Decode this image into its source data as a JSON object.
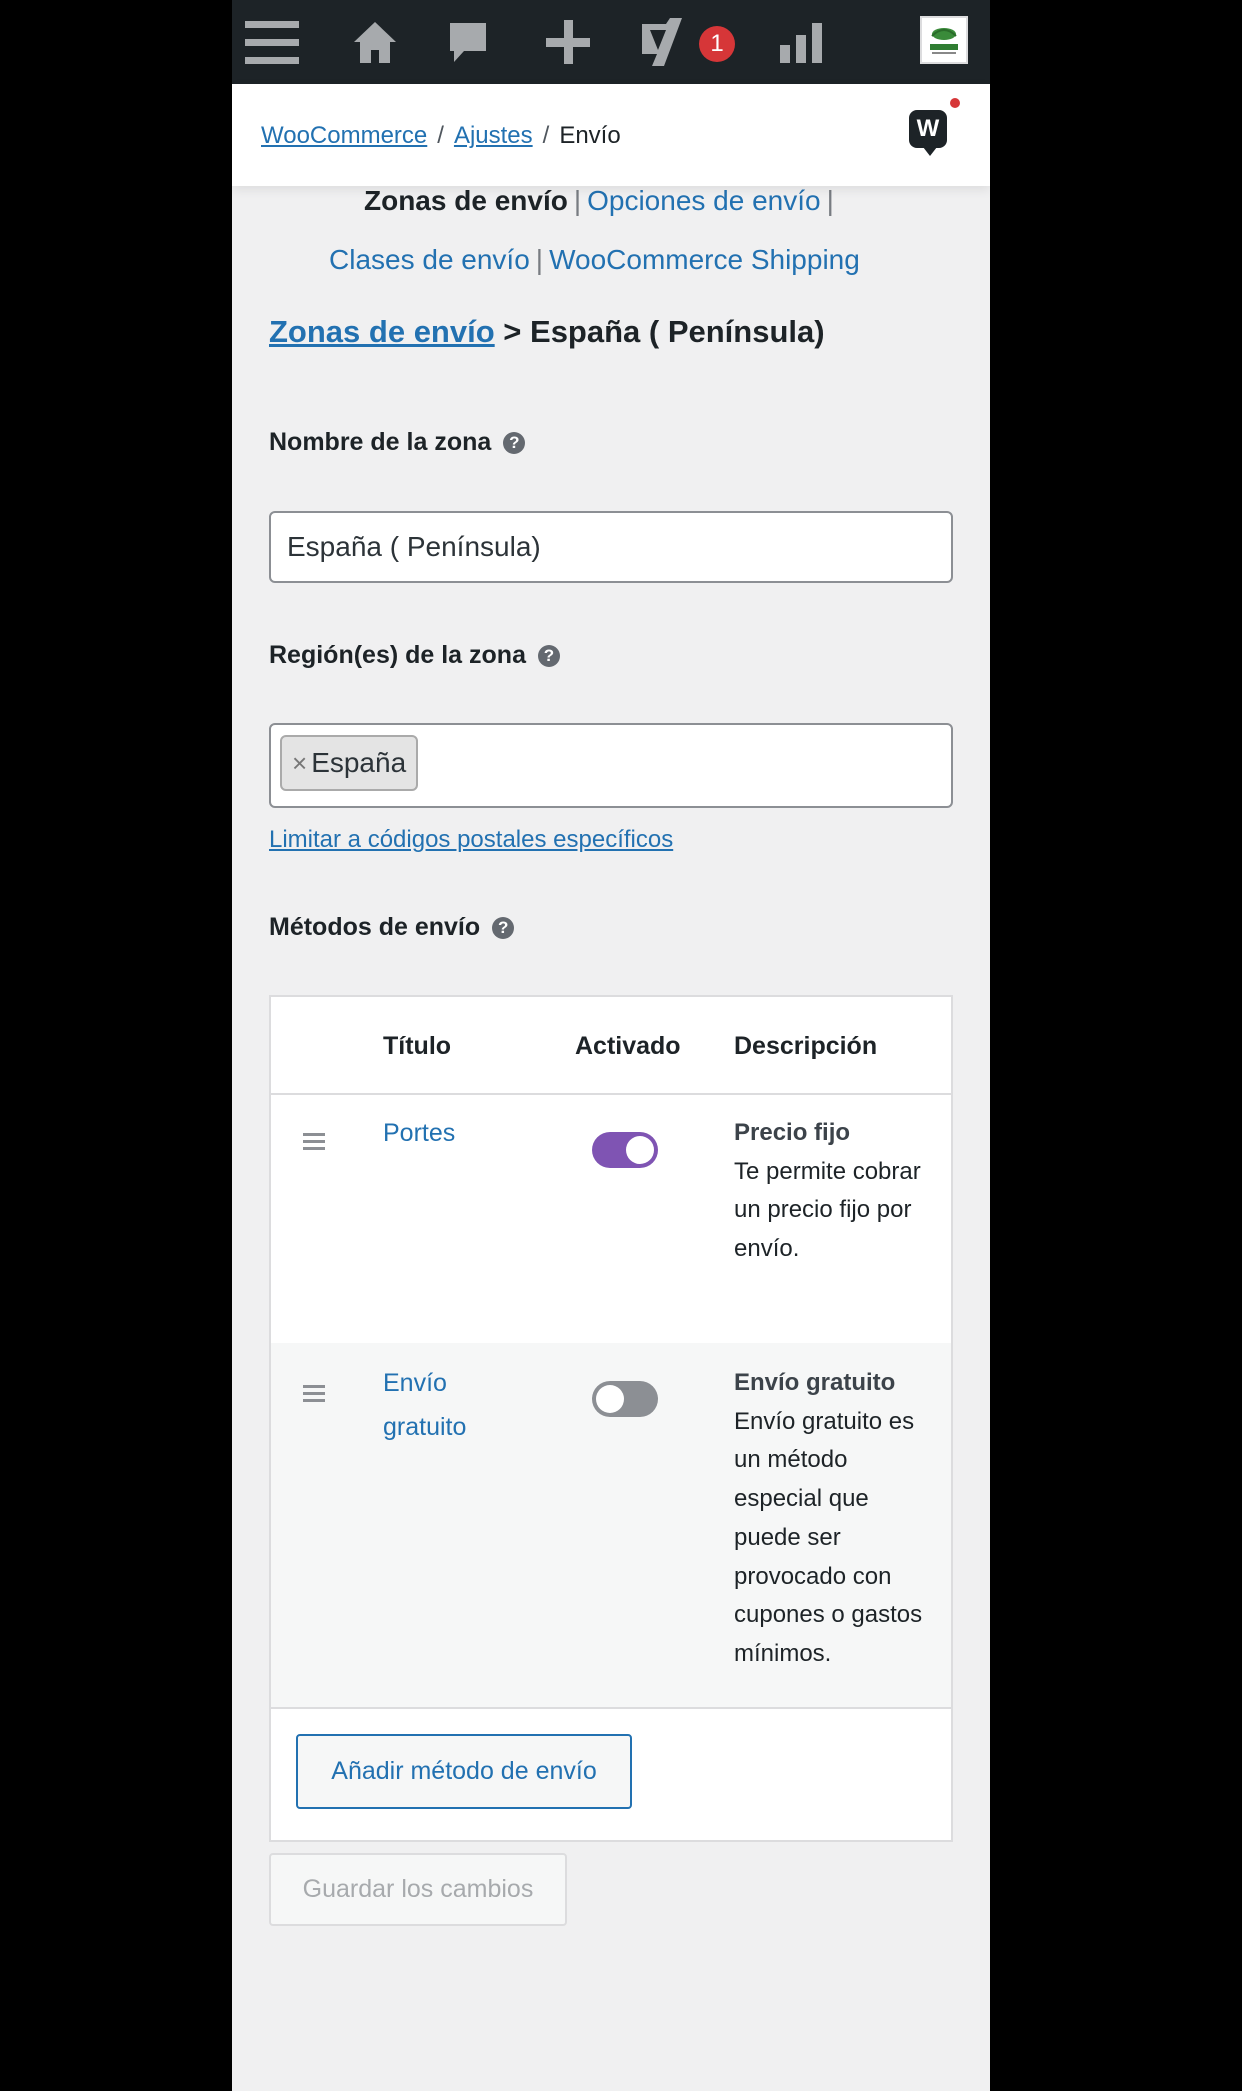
{
  "admin_bar": {
    "notification_count": "1",
    "icons": [
      "menu-icon",
      "home-icon",
      "comments-icon",
      "new-content-icon",
      "yoast-icon",
      "stats-icon"
    ]
  },
  "breadcrumb": {
    "items": [
      "WooCommerce",
      "Ajustes",
      "Envío"
    ],
    "separator": "/"
  },
  "help_bubble": {
    "letter": "W"
  },
  "subnav": {
    "current": "Zonas de envío",
    "links": [
      "Opciones de envío",
      "Clases de envío",
      "WooCommerce Shipping"
    ],
    "separator": "|"
  },
  "zone_heading": {
    "link": "Zonas de envío",
    "rest": "> España ( Península)"
  },
  "zone_name": {
    "label": "Nombre de la zona",
    "value": "España ( Península)"
  },
  "zone_regions": {
    "label": "Región(es) de la zona",
    "chips": [
      "España"
    ],
    "remove_symbol": "×",
    "postcode_link": "Limitar a códigos postales específicos"
  },
  "shipping_methods": {
    "label": "Métodos de envío",
    "columns": [
      "Título",
      "Activado",
      "Descripción"
    ],
    "rows": [
      {
        "title": "Portes",
        "enabled": true,
        "desc_title": "Precio fijo",
        "desc_text": "Te permite cobrar un precio fijo por envío."
      },
      {
        "title": "Envío gratuito",
        "enabled": false,
        "desc_title": "Envío gratuito",
        "desc_text": "Envío gratuito es un método especial que puede ser provocado con cupones o gastos mínimos."
      }
    ],
    "add_button": "Añadir método de envío"
  },
  "save_button": "Guardar los cambios",
  "help_icon": "?",
  "colors": {
    "admin_bar": "#1d2327",
    "link": "#2271b1",
    "toggle_on": "#7f54b3",
    "toggle_off": "#8c8f94",
    "badge": "#d63638"
  }
}
